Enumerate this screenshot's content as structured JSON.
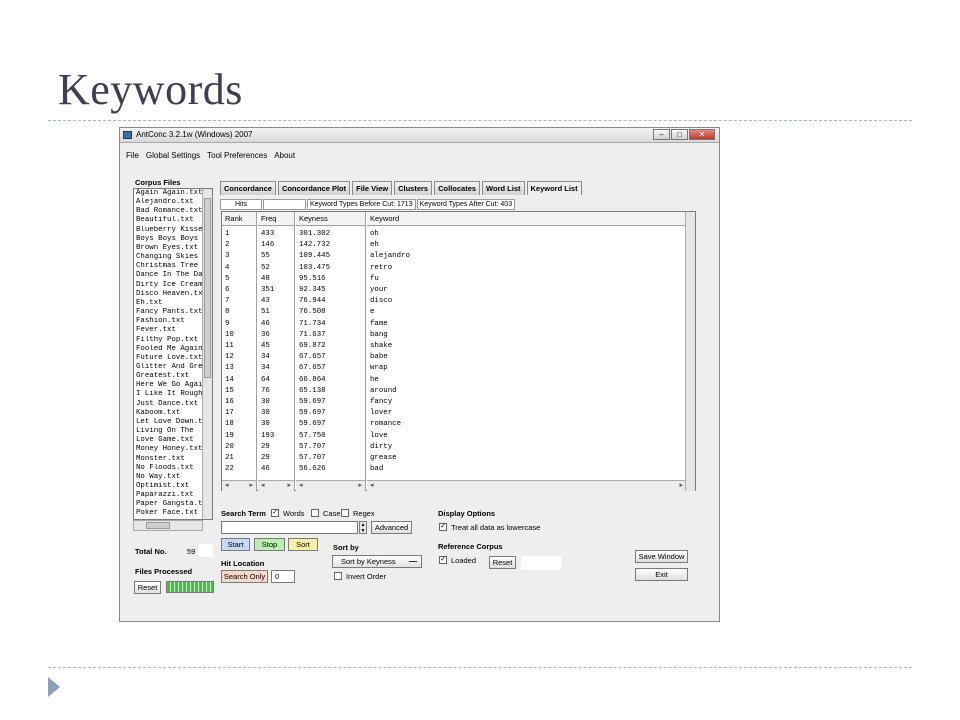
{
  "slide": {
    "title": "Keywords"
  },
  "window": {
    "title": "AntConc 3.2.1w (Windows) 2007",
    "menu": [
      "File",
      "Global Settings",
      "Tool Preferences",
      "About"
    ]
  },
  "corpus": {
    "title": "Corpus Files",
    "files": [
      "Again Again.txt",
      "Alejandro.txt",
      "Bad Romance.txt",
      "Beautiful.txt",
      "Blueberry Kisses",
      "Boys Boys Boys",
      "Brown Eyes.txt",
      "Changing Skies",
      "Christmas Tree",
      "Dance In The Dark",
      "Dirty Ice Cream",
      "Disco Heaven.txt",
      "Eh.txt",
      "Fancy Pants.txt",
      "Fashion.txt",
      "Fever.txt",
      "Filthy Pop.txt",
      "Fooled Me Again",
      "Future Love.txt",
      "Glitter And Grease",
      "Greatest.txt",
      "Here We Go Again",
      "I Like It Rough",
      "Just Dance.txt",
      "Kaboom.txt",
      "Let Love Down.txt",
      "Living On The",
      "Love Game.txt",
      "Money Honey.txt",
      "Monster.txt",
      "No Floods.txt",
      "No Way.txt",
      "Optimist.txt",
      "Paparazzi.txt",
      "Paper Gangsta.txt",
      "Poker Face.txt"
    ],
    "total_label": "Total No.",
    "total_value": "59",
    "processed_label": "Files Processed",
    "reset_label": "Reset"
  },
  "tabs": [
    {
      "label": "Concordance",
      "active": false
    },
    {
      "label": "Concordance Plot",
      "active": false
    },
    {
      "label": "File View",
      "active": false
    },
    {
      "label": "Clusters",
      "active": false
    },
    {
      "label": "Collocates",
      "active": false
    },
    {
      "label": "Word List",
      "active": false
    },
    {
      "label": "Keyword List",
      "active": true
    }
  ],
  "stats": {
    "hits_label": "Hits",
    "before_cut": "Keyword Types Before Cut: 1713",
    "after_cut": "Keyword Types After Cut: 403"
  },
  "table": {
    "headers": {
      "rank": "Rank",
      "freq": "Freq",
      "keyness": "Keyness",
      "keyword": "Keyword"
    },
    "rows": [
      [
        "1",
        "433",
        "301.302",
        "oh"
      ],
      [
        "2",
        "146",
        "142.732",
        "eh"
      ],
      [
        "3",
        "55",
        "109.445",
        "alejandro"
      ],
      [
        "4",
        "52",
        "103.475",
        "retro"
      ],
      [
        "5",
        "48",
        "95.516",
        "fu"
      ],
      [
        "6",
        "351",
        "92.345",
        "your"
      ],
      [
        "7",
        "43",
        "76.944",
        "disco"
      ],
      [
        "8",
        "51",
        "76.508",
        "e"
      ],
      [
        "9",
        "46",
        "71.734",
        "fame"
      ],
      [
        "10",
        "36",
        "71.637",
        "bang"
      ],
      [
        "11",
        "45",
        "69.872",
        "shake"
      ],
      [
        "12",
        "34",
        "67.657",
        "babe"
      ],
      [
        "13",
        "34",
        "67.657",
        "wrap"
      ],
      [
        "14",
        "64",
        "66.864",
        "he"
      ],
      [
        "15",
        "76",
        "65.138",
        "around"
      ],
      [
        "16",
        "30",
        "59.697",
        "fancy"
      ],
      [
        "17",
        "30",
        "59.697",
        "lover"
      ],
      [
        "18",
        "30",
        "59.697",
        "romance"
      ],
      [
        "19",
        "193",
        "57.750",
        "love"
      ],
      [
        "20",
        "29",
        "57.707",
        "dirty"
      ],
      [
        "21",
        "29",
        "57.707",
        "grease"
      ],
      [
        "22",
        "46",
        "56.626",
        "bad"
      ]
    ],
    "scroll_left": "◂",
    "scroll_right": "▸"
  },
  "search": {
    "label": "Search Term",
    "words_label": "Words",
    "case_label": "Case",
    "regex_label": "Regex",
    "value": "",
    "advanced_label": "Advanced",
    "start_label": "Start",
    "stop_label": "Stop",
    "sort_label": "Sort"
  },
  "hit_location": {
    "label": "Hit Location",
    "search_only_label": "Search Only",
    "value": "0"
  },
  "sort_by": {
    "label": "Sort by",
    "selected": "Sort by Keyness",
    "invert_label": "Invert Order"
  },
  "display_options": {
    "label": "Display Options",
    "lowercase_label": "Treat all data as lowercase"
  },
  "reference_corpus": {
    "label": "Reference Corpus",
    "loaded_label": "Loaded",
    "reset_label": "Reset"
  },
  "actions": {
    "save_label": "Save Window",
    "exit_label": "Exit"
  },
  "colors": {
    "start_button": "#c8d8f8",
    "stop_button": "#b8f0b0",
    "sort_button": "#f8f0a8",
    "search_only_button": "#f8d8c8",
    "progress": "#33cc33"
  }
}
